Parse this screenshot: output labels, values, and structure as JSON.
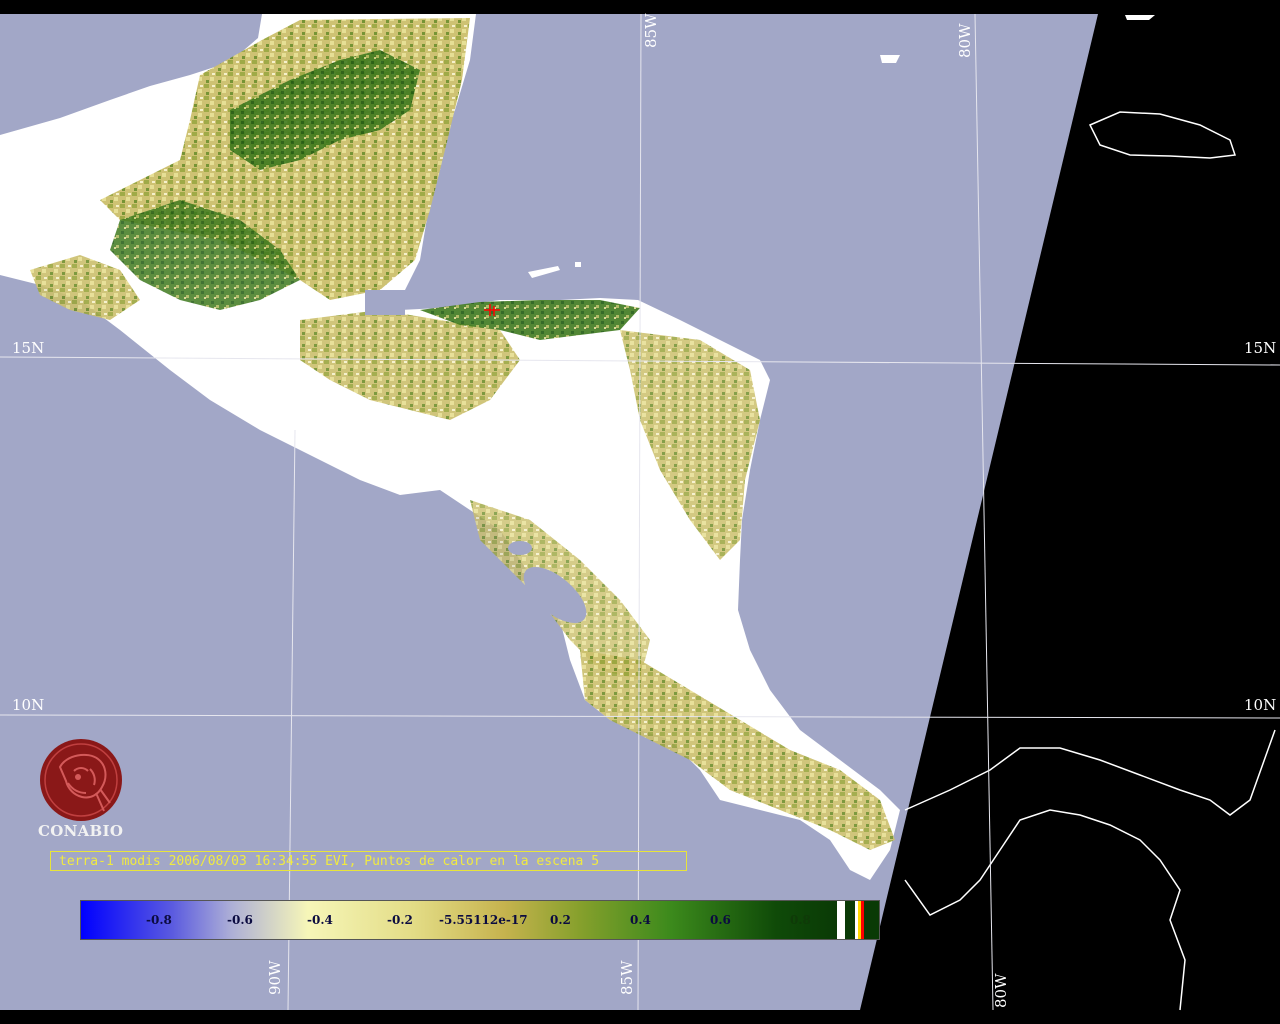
{
  "grid_labels": {
    "lon_85w_top": "85W",
    "lon_80w_top": "80W",
    "lat_15n_left": "15N",
    "lat_15n_right": "15N",
    "lat_10n_left": "10N",
    "lat_10n_right": "10N",
    "lon_90w_bottom": "90W",
    "lon_85w_bottom": "85W",
    "lon_80w_bottom": "80W"
  },
  "brand": {
    "name": "CONABIO"
  },
  "caption": {
    "text": "terra-1 modis 2006/08/03 16:34:55 EVI, Puntos de calor en la escena 5"
  },
  "colorbar": {
    "ticks": [
      "-0.8",
      "-0.6",
      "-0.4",
      "-0.2",
      "-5.55112e-17",
      "0.2",
      "0.4",
      "0.6",
      "0.8"
    ]
  },
  "colors": {
    "ocean": "#a2a7c7",
    "no_data": "#000000",
    "cloud": "#ffffff",
    "grid": "#e6e6ee",
    "caption": "#f0ea40",
    "logo": "#8a1818",
    "fire_point": "#ff0000"
  }
}
